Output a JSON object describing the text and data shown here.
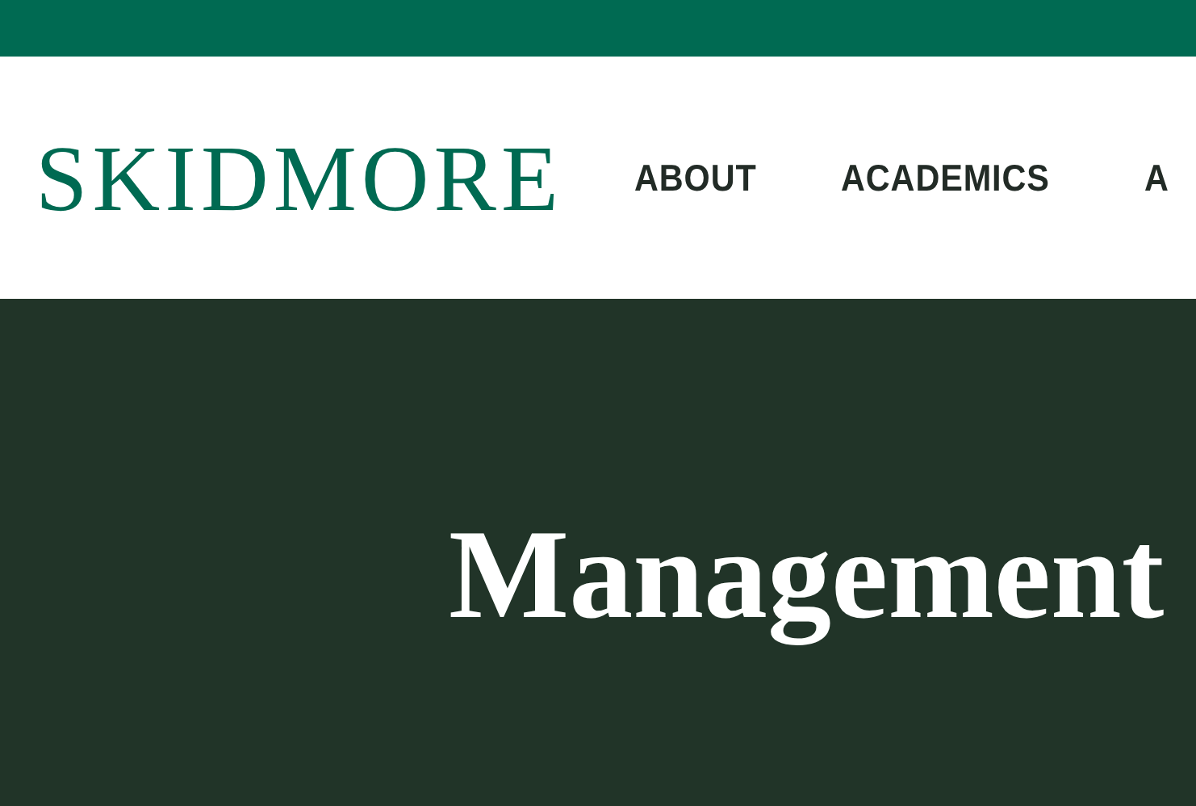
{
  "logo": "SKIDMORE",
  "nav": [
    "ABOUT",
    "ACADEMICS",
    "A"
  ],
  "hero": {
    "title": "Management"
  }
}
